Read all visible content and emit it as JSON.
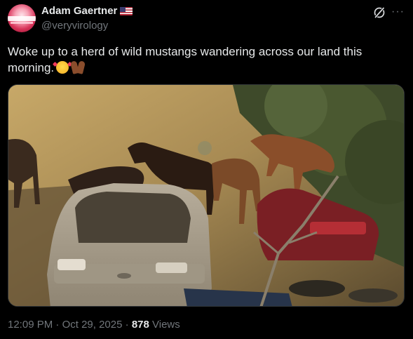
{
  "author": {
    "display_name": "Adam Gaertner",
    "handle": "@veryvirology",
    "flag_icon": "us-flag-icon"
  },
  "tweet": {
    "text": "Woke up to a herd of wild mustangs wandering across our land this morning.",
    "emojis": [
      "smiling-face-with-hearts-icon",
      "raising-hands-icon"
    ]
  },
  "meta": {
    "time": "12:09 PM",
    "separator": "·",
    "date": "Oct 29, 2025",
    "views_count": "878",
    "views_label": "Views"
  },
  "icons": {
    "grok": "grok-icon",
    "more": "more-icon",
    "more_glyph": "···"
  },
  "colors": {
    "background": "#000000",
    "text_primary": "#e7e9ea",
    "text_secondary": "#71767b",
    "border": "#2f3336"
  }
}
